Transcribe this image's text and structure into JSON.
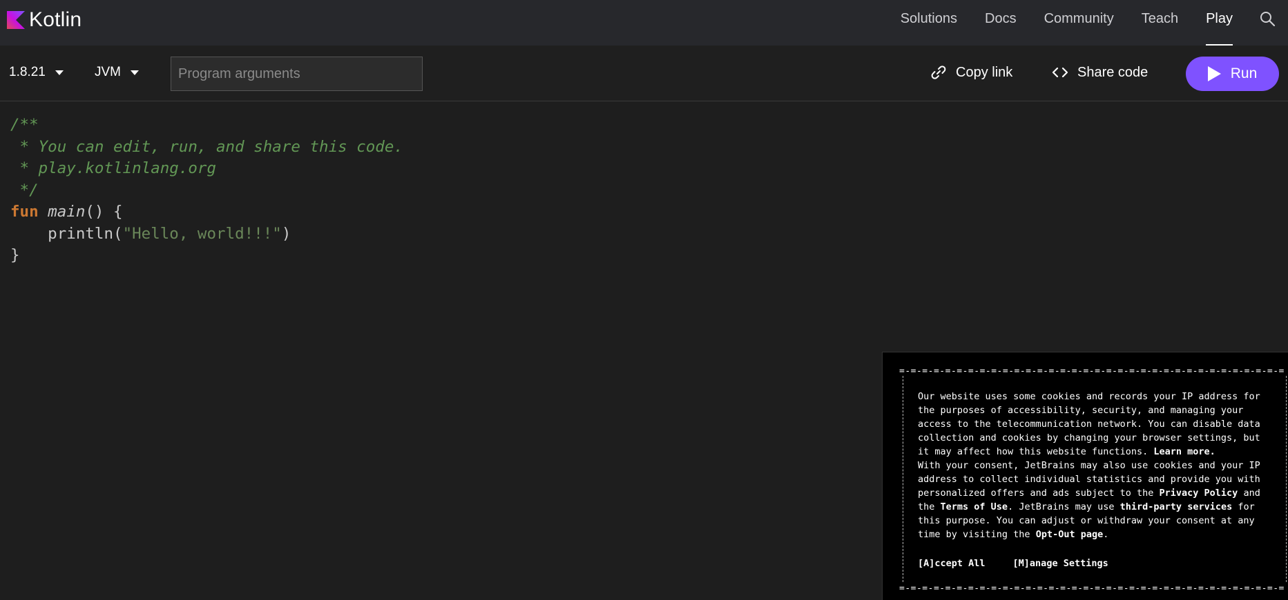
{
  "brand": {
    "logo_text": "Kotlin",
    "accent_color": "#7f52ff"
  },
  "nav": {
    "items": [
      {
        "label": "Solutions",
        "active": false
      },
      {
        "label": "Docs",
        "active": false
      },
      {
        "label": "Community",
        "active": false
      },
      {
        "label": "Teach",
        "active": false
      },
      {
        "label": "Play",
        "active": true
      }
    ],
    "search_icon": "search-icon"
  },
  "toolbar": {
    "version": "1.8.21",
    "platform": "JVM",
    "args_placeholder": "Program arguments",
    "args_value": "",
    "copy_link_label": "Copy link",
    "share_code_label": "Share code",
    "run_label": "Run"
  },
  "editor": {
    "lines": [
      "/**",
      " * You can edit, run, and share this code.",
      " * play.kotlinlang.org",
      " */",
      "fun main() {",
      "    println(\"Hello, world!!!\")",
      "}"
    ]
  },
  "cookie": {
    "p1": "Our website uses some cookies and records your IP address for the purposes of accessibility, security, and managing your access to the telecommunication network. You can disable data collection and cookies by changing your browser settings, but it may affect how this website functions.",
    "learn_more": "Learn more.",
    "p2_a": "With your consent, JetBrains may also use cookies and your IP address to collect individual statistics and provide you with personalized offers and ads subject to the",
    "privacy_policy": "Privacy Policy",
    "p2_b": "and the",
    "terms_of_use": "Terms of Use",
    "p2_c": ". JetBrains may use",
    "third_party": "third-party services",
    "p2_d": "for this purpose. You can adjust or withdraw your consent at any time by visiting the",
    "opt_out": "Opt-Out page",
    "p2_e": ".",
    "accept_label": "[A]ccept All",
    "manage_label": "[M]anage Settings",
    "border_text": "=-=-=-=-=-=-=-=-=-=-=-=-=-=-=-=-=-=-=-=-=-=-=-=-=-=-=-=-=-=-=-=-=-=-=-=-=-=-=-=-=-=-=-=-"
  }
}
